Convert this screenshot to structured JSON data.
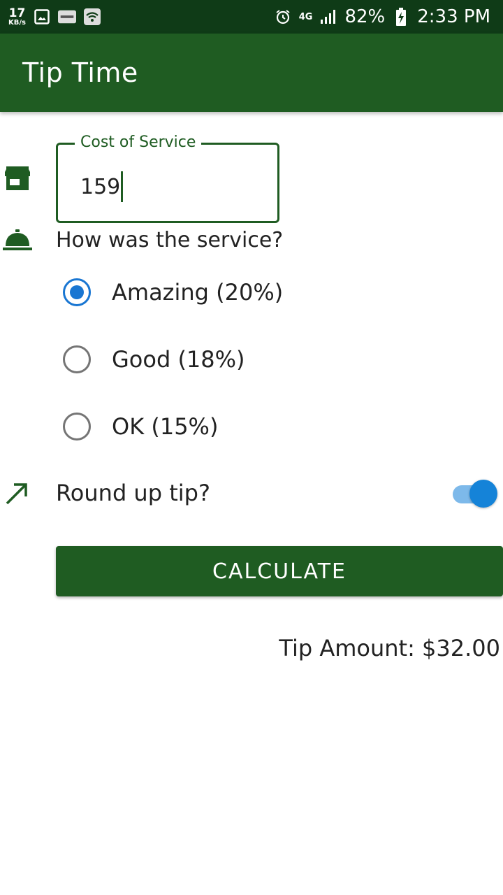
{
  "status_bar": {
    "net_speed": "17",
    "net_speed_unit": "KB/s",
    "network_type": "4G",
    "battery": "82%",
    "time": "2:33 PM",
    "icons": [
      "image-icon",
      "paytm-icon",
      "wifi-icon",
      "alarm-icon",
      "signal-icon",
      "battery-charging-icon"
    ]
  },
  "app_bar": {
    "title": "Tip Time"
  },
  "cost_field": {
    "label": "Cost of Service",
    "value": "159",
    "icon": "store-icon"
  },
  "service_question": {
    "text": "How was the service?",
    "icon": "room-service-icon"
  },
  "tip_options": [
    {
      "label": "Amazing (20%)",
      "checked": true
    },
    {
      "label": "Good (18%)",
      "checked": false
    },
    {
      "label": "OK (15%)",
      "checked": false
    }
  ],
  "round_up": {
    "label": "Round up tip?",
    "enabled": true,
    "icon": "trending-up-icon"
  },
  "calculate_button": {
    "label": "CALCULATE"
  },
  "result": {
    "text": "Tip Amount: $32.00"
  },
  "colors": {
    "primary": "#1f5c22",
    "status_bar": "#0f3b17",
    "radio_accent": "#1976d2",
    "switch_thumb": "#1583d8",
    "switch_track": "#7db9ea"
  }
}
